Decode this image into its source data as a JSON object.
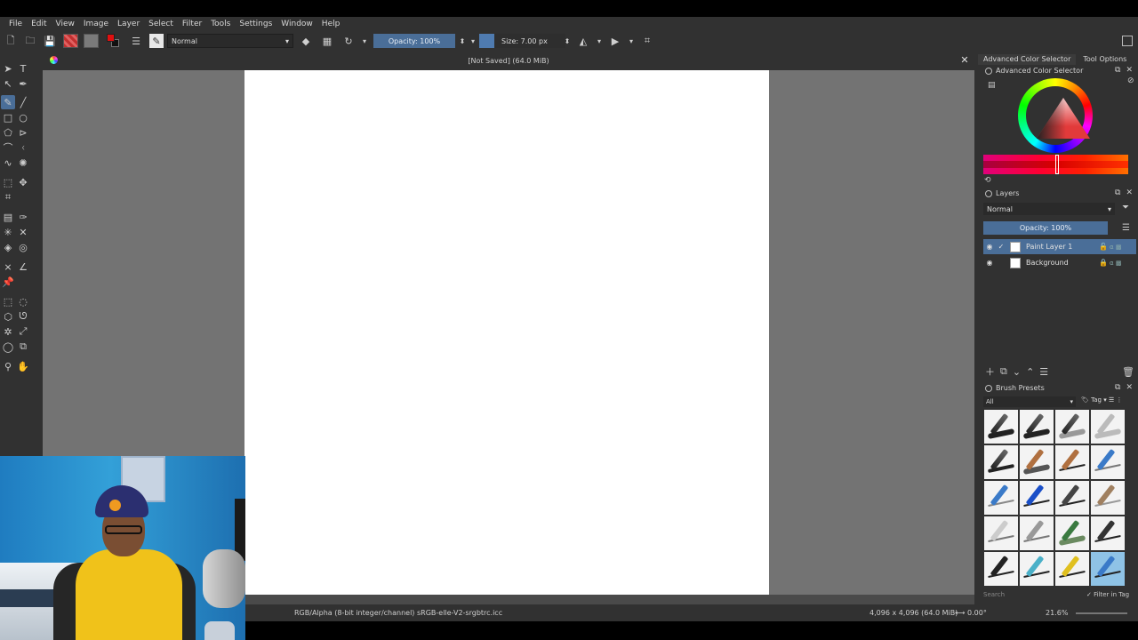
{
  "menu": [
    "File",
    "Edit",
    "View",
    "Image",
    "Layer",
    "Select",
    "Filter",
    "Tools",
    "Settings",
    "Window",
    "Help"
  ],
  "toolbar": {
    "blend_mode": "Normal",
    "opacity_label": "Opacity: 100%",
    "size_label": "Size: 7.00 px"
  },
  "document": {
    "title": "[Not Saved]  (64.0 MiB)"
  },
  "dock": {
    "tabs": [
      "Advanced Color Selector",
      "Tool Options"
    ],
    "color_selector_title": "Advanced Color Selector",
    "layers_title": "Layers",
    "layers_blend": "Normal",
    "layers_opacity": "Opacity:  100%",
    "layers": [
      {
        "name": "Paint Layer 1",
        "selected": true
      },
      {
        "name": "Background",
        "selected": false,
        "locked": true
      }
    ],
    "brush_title": "Brush Presets",
    "brush_filter": "All",
    "tag_label": "Tag",
    "search_placeholder": "Search",
    "filter_in_tag": "Filter in Tag"
  },
  "status": {
    "color_info": "RGB/Alpha (8-bit integer/channel)  sRGB-elle-V2-srgbtrc.icc",
    "size_info": "4,096 x 4,096 (64.0 MiB)",
    "rotation": "0.00°",
    "zoom": "21.6%"
  },
  "colors": {
    "accent": "#4a6e98",
    "foreground": "#e01010",
    "background": "#111111",
    "ui_bg": "#313131",
    "canvas_bg": "#737373"
  }
}
